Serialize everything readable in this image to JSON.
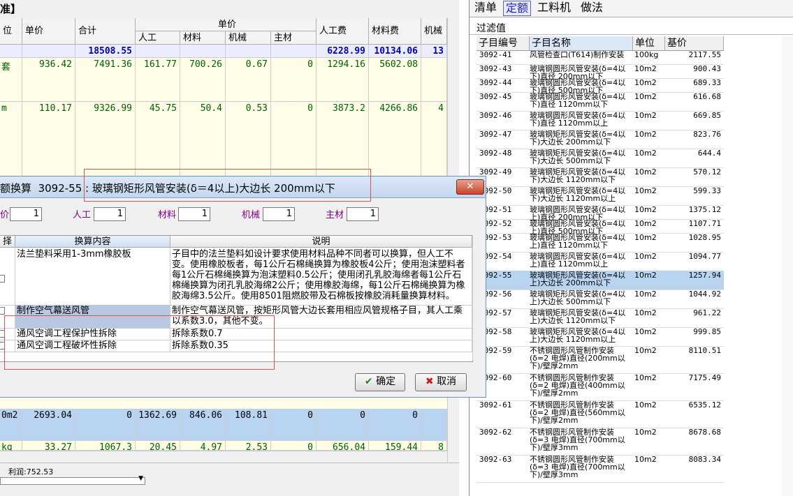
{
  "left_panel": {
    "header_title": "准】",
    "columns": {
      "unit": "位",
      "unit_price": "单价",
      "total": "合计",
      "unit_price_group": "单价",
      "labor": "人工",
      "material": "材料",
      "machine": "机械",
      "main_mat": "主材",
      "labor_fee": "人工费",
      "material_fee": "材料费",
      "machine_fee": "机械"
    },
    "summary_row": {
      "total": "18508.55",
      "labor_fee": "6228.99",
      "material_fee": "10134.06",
      "machine_fee": "13"
    },
    "rows": [
      {
        "unit": "套",
        "unit_price": "936.42",
        "total": "7491.36",
        "labor": "161.77",
        "material": "700.26",
        "machine": "0.67",
        "main_mat": "0",
        "labor_fee": "1294.16",
        "material_fee": "5602.08",
        "machine_fee": ""
      },
      {
        "unit": "m",
        "unit_price": "110.17",
        "total": "9326.99",
        "labor": "45.75",
        "material": "50.4",
        "machine": "0.53",
        "main_mat": "0",
        "labor_fee": "3873.2",
        "material_fee": "4266.86",
        "machine_fee": "4"
      },
      {
        "unit": "0m2",
        "unit_price": "2693.04",
        "total": "0",
        "labor": "1362.69",
        "material": "846.06",
        "machine": "108.81",
        "main_mat": "0",
        "labor_fee": "0",
        "material_fee": "0",
        "machine_fee": ""
      },
      {
        "unit": "kg",
        "unit_price": "33.27",
        "total": "1067.3",
        "labor": "20.45",
        "material": "4.97",
        "machine": "2.53",
        "main_mat": "0",
        "labor_fee": "656.04",
        "material_fee": "159.44",
        "machine_fee": "8"
      }
    ],
    "status_text": "利润:752.53"
  },
  "right_panel": {
    "tabs": [
      "清单",
      "定额",
      "工料机",
      "做法"
    ],
    "active_tab": "定额",
    "filter_label": "过滤值",
    "columns": {
      "code": "子目编号",
      "name": "子目名称",
      "unit": "单位",
      "price": "基价"
    },
    "rows": [
      {
        "code": "3092-41",
        "name": "风管检查口(T614)制作安装",
        "unit": "100kg",
        "price": "2117.55"
      },
      {
        "code": "3092-43",
        "name": "玻璃钢圆形风管安装(δ=4以下)直径 200mm以下",
        "unit": "10m2",
        "price": "900.43"
      },
      {
        "code": "3092-44",
        "name": "玻璃钢圆形风管安装(δ=4以下)直径 500mm以下",
        "unit": "10m2",
        "price": "689.33"
      },
      {
        "code": "3092-45",
        "name": "玻璃钢圆形风管安装(δ=4以下)直径 1120mm以下",
        "unit": "10m2",
        "price": "616.68"
      },
      {
        "code": "3092-46",
        "name": "玻璃钢圆形风管安装(δ=4以下)直径 1120mm以上",
        "unit": "10m2",
        "price": "669.85"
      },
      {
        "code": "3092-47",
        "name": "玻璃钢矩形风管安装(δ=4以下)大边长 200mm以下",
        "unit": "10m2",
        "price": "823.76"
      },
      {
        "code": "3092-48",
        "name": "玻璃钢矩形风管安装(δ=4以下)大边长 500mm以下",
        "unit": "10m2",
        "price": "644.4"
      },
      {
        "code": "3092-49",
        "name": "玻璃钢矩形风管安装(δ=4以下)大边长 1120mm以下",
        "unit": "10m2",
        "price": "570.12"
      },
      {
        "code": "3092-50",
        "name": "玻璃钢矩形风管安装(δ=4以下)大边长 1120mm以上",
        "unit": "10m2",
        "price": "599.33"
      },
      {
        "code": "3092-51",
        "name": "玻璃钢圆形风管安装(δ=4以上)直径 200mm以下",
        "unit": "10m2",
        "price": "1375.12"
      },
      {
        "code": "3092-52",
        "name": "玻璃钢圆形风管安装(δ=4以上)直径 500mm以下",
        "unit": "10m2",
        "price": "1107.71"
      },
      {
        "code": "3092-53",
        "name": "玻璃钢圆形风管安装(δ=4以上)直径 1120mm以下",
        "unit": "10m2",
        "price": "1028.95"
      },
      {
        "code": "3092-54",
        "name": "玻璃钢圆形风管安装(δ=4以上)直径 1120mm以上",
        "unit": "10m2",
        "price": "1094.77"
      },
      {
        "code": "3092-55",
        "name": "玻璃钢矩形风管安装(δ=4以上)大边长 200mm以下",
        "unit": "10m2",
        "price": "1257.94"
      },
      {
        "code": "3092-56",
        "name": "玻璃钢矩形风管安装(δ=4以上)大边长 500mm以下",
        "unit": "10m2",
        "price": "1044.92"
      },
      {
        "code": "3092-57",
        "name": "玻璃钢矩形风管安装(δ=4以上)大边长 1120mm以下",
        "unit": "10m2",
        "price": "961.22"
      },
      {
        "code": "3092-58",
        "name": "玻璃钢矩形风管安装(δ=4以上)大边长 1120mm以上",
        "unit": "10m2",
        "price": "999.85"
      },
      {
        "code": "3092-59",
        "name": "不锈钢圆形风管制作安装(δ=2 电焊)直径(200mm以下)/壁厚2mm",
        "unit": "10m2",
        "price": "8110.51"
      },
      {
        "code": "3092-60",
        "name": "不锈钢圆形风管制作安装(δ=2 电焊)直径(400mm以下)/壁厚2mm",
        "unit": "10m2",
        "price": "7175.49"
      },
      {
        "code": "3092-61",
        "name": "不锈钢圆形风管制作安装(δ=2 电焊)直径(560mm以下)/壁厚2mm",
        "unit": "10m2",
        "price": "6535.12"
      },
      {
        "code": "3092-62",
        "name": "不锈钢圆形风管制作安装(δ=3 电焊)直径(700mm以下)/壁厚3mm",
        "unit": "10m2",
        "price": "8678.68"
      },
      {
        "code": "3092-63",
        "name": "不锈钢圆形风管制作安装(δ=3 电焊)直径(700mm以下)/壁厚3mm",
        "unit": "10m2",
        "price": "8083.34"
      }
    ],
    "selected_code": "3092-55"
  },
  "dialog": {
    "title_prefix": "额换算",
    "title_code": "3092-55",
    "title_name": "玻璃钢矩形风管安装(δ＝4以上)大边长 200mm以下",
    "coef_labels": [
      "价",
      "人工",
      "材料",
      "机械",
      "主材"
    ],
    "coef_values": [
      "1",
      "1",
      "1",
      "1",
      "1"
    ],
    "grid_headers": {
      "select": "择",
      "content": "换算内容",
      "desc": "说明"
    },
    "grid_rows": [
      {
        "content": "法兰垫料采用1-3mm橡胶板",
        "desc": "子目中的法兰垫料如设计要求使用材料品种不同者可以换算，但人工不变。使用橡胶板者，每1公斤石棉绳换算为橡胶板4公斤；使用泡沫塑料者每1公斤石棉绳换算为泡沫塑料0.5公斤；使用闭孔乳胶海绵者每1公斤石棉绳换算为闭孔乳胶海绵2公斤；使用橡胶海绵，每1公斤石棉绳换算为橡胶海绵3.5公斤。使用8501阻燃胶带及石棉板按橡胶消耗量换算材料。"
      },
      {
        "content": "制作空气幕送风管",
        "desc": "制作空气幕送风管，按矩形风管大边长套用相应风管规格子目，其人工乘以系数3.0，其他不变。"
      },
      {
        "content": "通风空调工程保护性拆除",
        "desc": "拆除系数0.7"
      },
      {
        "content": "通风空调工程破坏性拆除",
        "desc": "拆除系数0.35"
      }
    ],
    "ok_label": "确定",
    "cancel_label": "取消",
    "close_label": "✕"
  }
}
